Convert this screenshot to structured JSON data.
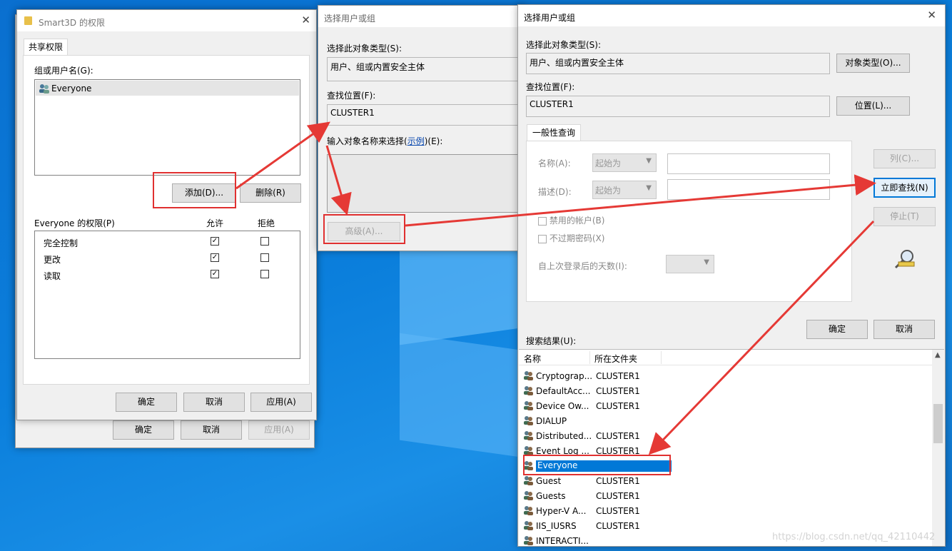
{
  "perm": {
    "title": "Smart3D 的权限",
    "tab": "共享权限",
    "group_label": "组或用户名(G):",
    "user": "Everyone",
    "add": "添加(D)...",
    "remove": "删除(R)",
    "perm_label": "Everyone 的权限(P)",
    "allow": "允许",
    "deny": "拒绝",
    "rows": [
      {
        "name": "完全控制",
        "allow": true,
        "deny": false
      },
      {
        "name": "更改",
        "allow": true,
        "deny": false
      },
      {
        "name": "读取",
        "allow": true,
        "deny": false
      }
    ],
    "ok": "确定",
    "cancel": "取消",
    "apply": "应用(A)"
  },
  "back": {
    "ok": "确定",
    "cancel": "取消",
    "apply": "应用(A)"
  },
  "sel1": {
    "title": "选择用户或组",
    "type_label": "选择此对象类型(S):",
    "type_value": "用户、组或内置安全主体",
    "loc_label": "查找位置(F):",
    "loc_value": "CLUSTER1",
    "enter_pre": "输入对象名称来选择(",
    "enter_link": "示例",
    "enter_post": ")(E):",
    "advanced": "高级(A)..."
  },
  "sel2": {
    "title": "选择用户或组",
    "type_label": "选择此对象类型(S):",
    "type_value": "用户、组或内置安全主体",
    "type_btn": "对象类型(O)...",
    "loc_label": "查找位置(F):",
    "loc_value": "CLUSTER1",
    "loc_btn": "位置(L)...",
    "tab": "一般性查询",
    "name_label": "名称(A):",
    "desc_label": "描述(D):",
    "starts_with": "起始为",
    "disabled_acct": "禁用的帐户(B)",
    "no_expire": "不过期密码(X)",
    "days_label": "自上次登录后的天数(I):",
    "col_btn": "列(C)...",
    "find_btn": "立即查找(N)",
    "stop_btn": "停止(T)",
    "ok": "确定",
    "cancel": "取消",
    "results_label": "搜索结果(U):",
    "col_name": "名称",
    "col_folder": "所在文件夹",
    "results": [
      {
        "name": "Cryptograp...",
        "folder": "CLUSTER1"
      },
      {
        "name": "DefaultAcc...",
        "folder": "CLUSTER1"
      },
      {
        "name": "Device Ow...",
        "folder": "CLUSTER1"
      },
      {
        "name": "DIALUP",
        "folder": ""
      },
      {
        "name": "Distributed...",
        "folder": "CLUSTER1"
      },
      {
        "name": "Event Log ...",
        "folder": "CLUSTER1"
      },
      {
        "name": "Everyone",
        "folder": ""
      },
      {
        "name": "Guest",
        "folder": "CLUSTER1"
      },
      {
        "name": "Guests",
        "folder": "CLUSTER1"
      },
      {
        "name": "Hyper-V A...",
        "folder": "CLUSTER1"
      },
      {
        "name": "IIS_IUSRS",
        "folder": "CLUSTER1"
      },
      {
        "name": "INTERACTI...",
        "folder": ""
      }
    ]
  },
  "watermark": "https://blog.csdn.net/qq_42110442"
}
